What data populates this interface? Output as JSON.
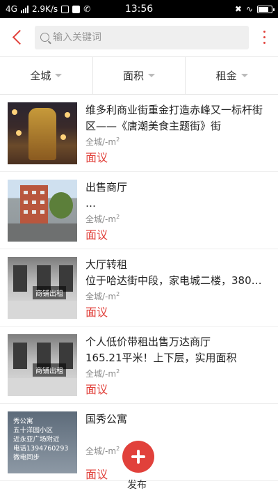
{
  "status_bar": {
    "network": "4G",
    "speed": "2.9K/s",
    "time": "13:56"
  },
  "header": {
    "search_placeholder": "输入关键词"
  },
  "filters": [
    {
      "label": "全城"
    },
    {
      "label": "面积"
    },
    {
      "label": "租金"
    }
  ],
  "listings": [
    {
      "title": "维多利商业街重金打造赤峰又一标杆街区——《唐潮美食主题街》街",
      "area_prefix": "全城/-m",
      "area_unit": "2",
      "price": "面议"
    },
    {
      "title": "出售商厅\n…",
      "area_prefix": "全城/-m",
      "area_unit": "2",
      "price": "面议"
    },
    {
      "title": "大厅转租\n位于哈达街中段，家电城二楼，380…",
      "area_prefix": "全城/-m",
      "area_unit": "2",
      "price": "面议",
      "thumb_sign": "商铺出租"
    },
    {
      "title": "个人低价带租出售万达商厅\n165.21平米！上下层，实用面积",
      "area_prefix": "全城/-m",
      "area_unit": "2",
      "price": "面议",
      "thumb_sign": "商铺出租"
    },
    {
      "title": "国秀公寓",
      "area_prefix": "全城/-m",
      "area_unit": "2",
      "price": "面议",
      "thumb_lines": [
        "秀公寓",
        "五十洋园小区",
        "近永亚广场附近",
        "电话1394760293",
        "微电同步"
      ]
    }
  ],
  "fab": {
    "label": "发布",
    "accent": "#e1413b"
  }
}
